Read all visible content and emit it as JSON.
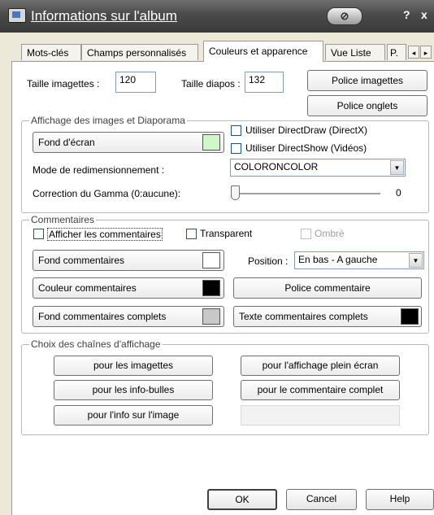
{
  "window": {
    "title": "Informations sur l'album",
    "help": "?",
    "close": "x"
  },
  "tabs": [
    {
      "label": "Mots-clés"
    },
    {
      "label": "Champs personnalisés"
    },
    {
      "label": "Couleurs et apparence",
      "active": true
    },
    {
      "label": "Vue Liste"
    },
    {
      "label": "P."
    }
  ],
  "tab_scroll": {
    "left": "◂",
    "right": "▸"
  },
  "top": {
    "thumb_size_label": "Taille imagettes :",
    "thumb_size_value": "120",
    "slide_size_label": "Taille diapos :",
    "slide_size_value": "132",
    "font_thumbs_button": "Police imagettes",
    "font_tabs_button": "Police onglets"
  },
  "display": {
    "legend": "Affichage des images et Diaporama",
    "background_button": "Fond d'écran",
    "background_color": "#cff7c8",
    "directdraw_label": "Utiliser DirectDraw (DirectX)",
    "directshow_label": "Utiliser DirectShow (Vidéos)",
    "resize_mode_label": "Mode de redimensionnement :",
    "resize_mode_value": "COLORONCOLOR",
    "gamma_label": "Correction du Gamma (0:aucune):",
    "gamma_value": "0"
  },
  "comments": {
    "legend": "Commentaires",
    "show_label": "Afficher les commentaires",
    "transparent_label": "Transparent",
    "shadow_label": "Ombré",
    "bg_button": "Fond commentaires",
    "bg_color": "#ffffff",
    "position_label": "Position :",
    "position_value": "En bas - A gauche",
    "color_button": "Couleur commentaires",
    "color_value": "#000000",
    "font_button": "Police commentaire",
    "full_bg_button": "Fond commentaires complets",
    "full_bg_color": "#c8c8c8",
    "full_text_button": "Texte commentaires complets",
    "full_text_color": "#000000"
  },
  "chains": {
    "legend": "Choix des chaînes d'affichage",
    "thumbs_button": "pour les imagettes",
    "fullscreen_button": "pour l'affichage plein écran",
    "tooltips_button": "pour les info-bulles",
    "full_comment_button": "pour le commentaire complet",
    "image_info_button": "pour l'info sur l'image"
  },
  "dialog_buttons": {
    "ok": "OK",
    "cancel": "Cancel",
    "help": "Help"
  },
  "icons": {
    "app": "album-icon",
    "dropdown": "chevron-down-icon",
    "tab_left": "scroll-left-icon",
    "tab_right": "scroll-right-icon"
  }
}
